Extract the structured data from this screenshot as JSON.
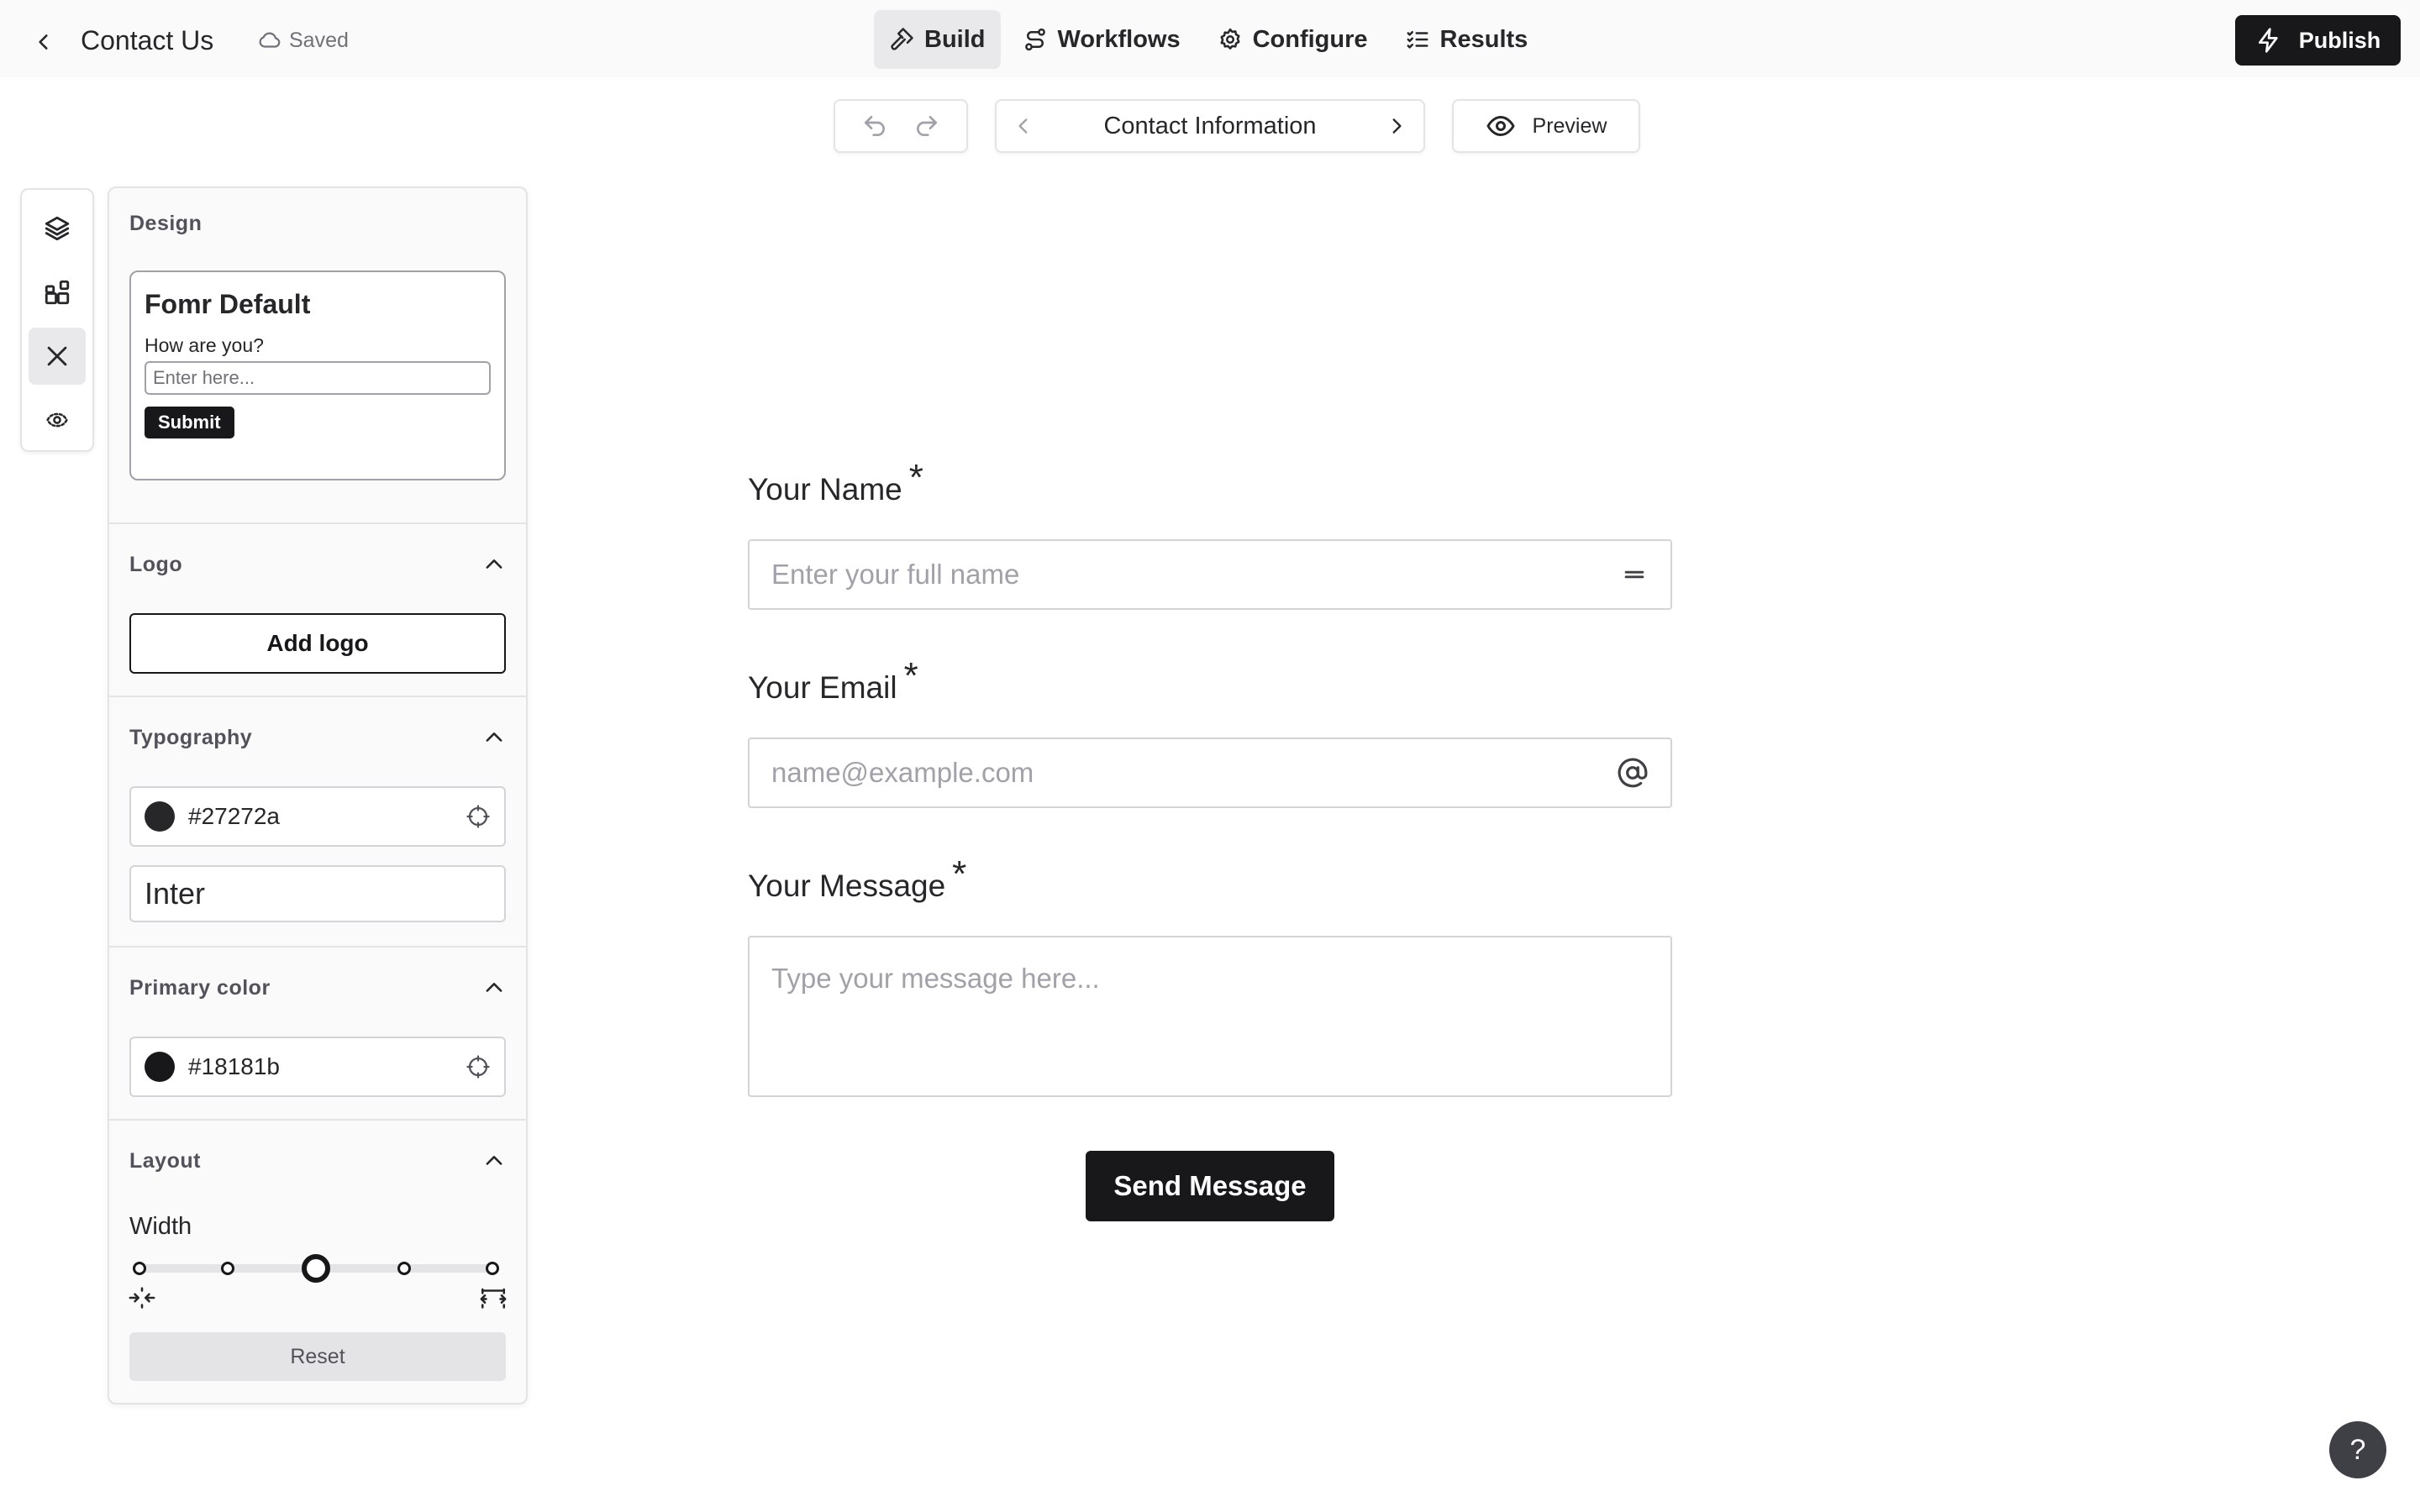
{
  "app": {
    "title": "Contact Us",
    "save_status": "Saved"
  },
  "top_tabs": [
    {
      "label": "Build",
      "icon": "hammer-icon",
      "active": true
    },
    {
      "label": "Workflows",
      "icon": "workflow-icon",
      "active": false
    },
    {
      "label": "Configure",
      "icon": "gear-icon",
      "active": false
    },
    {
      "label": "Results",
      "icon": "list-checks-icon",
      "active": false
    }
  ],
  "publish": {
    "label": "Publish",
    "icon": "lightning-icon"
  },
  "toolbar": {
    "undo_icon": "undo-icon",
    "redo_icon": "redo-icon",
    "current_page": "Contact Information",
    "preview_label": "Preview"
  },
  "rail": [
    {
      "icon": "layers-icon",
      "active": false
    },
    {
      "icon": "add-block-icon",
      "active": false
    },
    {
      "icon": "close-icon",
      "active": true
    },
    {
      "icon": "logic-icon",
      "active": false
    }
  ],
  "design_panel": {
    "title": "Design",
    "theme": {
      "name": "Fomr Default",
      "question": "How are you?",
      "placeholder": "Enter here...",
      "submit": "Submit"
    },
    "logo": {
      "title": "Logo",
      "button": "Add logo"
    },
    "typography": {
      "title": "Typography",
      "color": "#27272a",
      "font": "Inter"
    },
    "primary_color": {
      "title": "Primary color",
      "color": "#18181b"
    },
    "layout": {
      "title": "Layout",
      "width_label": "Width",
      "width_steps": 5,
      "width_selected_index": 2,
      "reset": "Reset"
    }
  },
  "form": {
    "fields": [
      {
        "label": "Your Name",
        "required_mark": "*",
        "placeholder": "Enter your full name",
        "icon": "short-text-icon"
      },
      {
        "label": "Your Email",
        "required_mark": "*",
        "placeholder": "name@example.com",
        "icon": "at-sign-icon"
      },
      {
        "label": "Your Message",
        "required_mark": "*",
        "placeholder": "Type your message here..."
      }
    ],
    "submit_label": "Send Message"
  },
  "help": {
    "label": "?"
  },
  "colors": {
    "accent": "#18181b",
    "text": "#27272a",
    "muted": "#71717a",
    "border": "#e4e4e7",
    "active_bg": "#e9e9eb"
  }
}
